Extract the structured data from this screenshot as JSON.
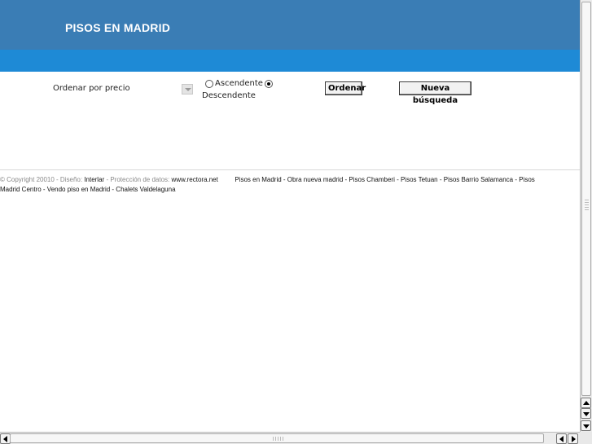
{
  "header": {
    "title": "PISOS EN MADRID"
  },
  "sort": {
    "label": "Ordenar por precio",
    "ascending_label": "Ascendente",
    "descending_label": "Descendente",
    "selected": "Descendente",
    "order_button": "Ordenar",
    "new_search_button": "Nueva búsqueda"
  },
  "footer": {
    "copyright": "© Copyright 20010 - Diseño:",
    "designer": "Interlar",
    "privacy_prefix": "- Protección de datos:",
    "privacy_site": "www.rectora.net",
    "links_line1": "Pisos en Madrid - Obra nueva madrid  -  Pisos Chamberi -  Pisos Tetuan - Pisos Barrio Salamanca - Pisos",
    "links_line2": "Madrid Centro - Vendo piso en Madrid - Chalets Valdelaguna"
  }
}
